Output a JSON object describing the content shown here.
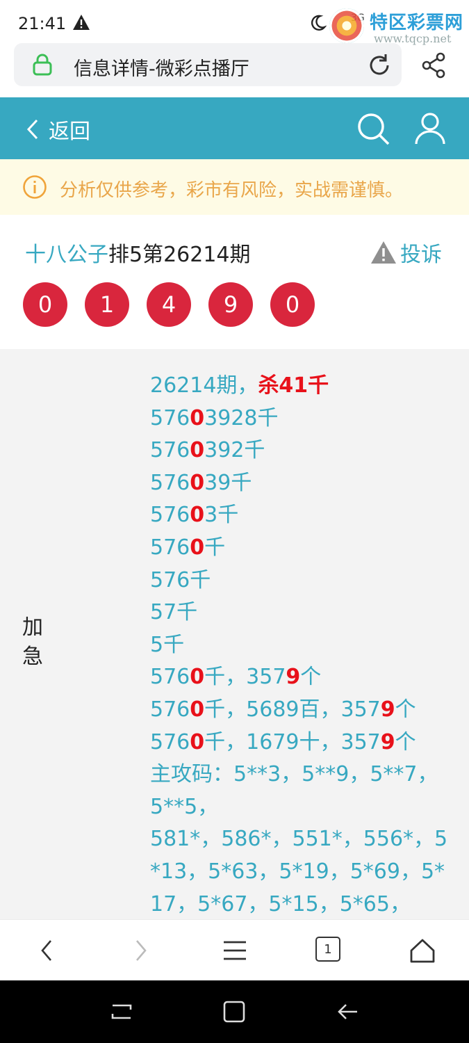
{
  "status": {
    "time": "21:41",
    "right_text": "3G"
  },
  "watermark": {
    "title": "特区彩票网",
    "url": "www.tqcp.net"
  },
  "browser": {
    "url_text": "信息详情-微彩点播厅"
  },
  "header": {
    "back_label": "返回"
  },
  "notice": {
    "text": "分析仅供参考，彩市有风险，实战需谨慎。"
  },
  "post": {
    "author": "十八公子",
    "title_rest": "排5第26214期",
    "complain_label": "投诉",
    "numbers": [
      "0",
      "1",
      "4",
      "9",
      "0"
    ]
  },
  "content": {
    "side_label": "加急",
    "lines": [
      [
        {
          "t": "26214期，"
        },
        {
          "t": "杀41千",
          "r": true
        }
      ],
      [
        {
          "t": "576"
        },
        {
          "t": "0",
          "r": true
        },
        {
          "t": "3928千"
        }
      ],
      [
        {
          "t": "576"
        },
        {
          "t": "0",
          "r": true
        },
        {
          "t": "392千"
        }
      ],
      [
        {
          "t": "576"
        },
        {
          "t": "0",
          "r": true
        },
        {
          "t": "39千"
        }
      ],
      [
        {
          "t": "576"
        },
        {
          "t": "0",
          "r": true
        },
        {
          "t": "3千"
        }
      ],
      [
        {
          "t": "576"
        },
        {
          "t": "0",
          "r": true
        },
        {
          "t": "千"
        }
      ],
      [
        {
          "t": "576千"
        }
      ],
      [
        {
          "t": "57千"
        }
      ],
      [
        {
          "t": "5千"
        }
      ],
      [
        {
          "t": "576"
        },
        {
          "t": "0",
          "r": true
        },
        {
          "t": "千，357"
        },
        {
          "t": "9",
          "r": true
        },
        {
          "t": "个"
        }
      ],
      [
        {
          "t": "576"
        },
        {
          "t": "0",
          "r": true
        },
        {
          "t": "千，5689百，357"
        },
        {
          "t": "9",
          "r": true
        },
        {
          "t": "个"
        }
      ],
      [
        {
          "t": "576"
        },
        {
          "t": "0",
          "r": true
        },
        {
          "t": "千，1679十，357"
        },
        {
          "t": "9",
          "r": true
        },
        {
          "t": "个"
        }
      ],
      [
        {
          "t": "主攻码：5**3，5**9，5**7，"
        }
      ],
      [
        {
          "t": "5**5，"
        }
      ],
      [
        {
          "t": "581*，586*，551*，556*，5"
        }
      ],
      [
        {
          "t": "*13，5*63，5*19，5*69，5*"
        }
      ],
      [
        {
          "t": "17，5*67，5*15，5*65，"
        }
      ]
    ]
  },
  "bottom_nav": {
    "tab_count": "1"
  },
  "colors": {
    "header": "#37a8c1",
    "ball": "#d9263d",
    "highlight": "#e8111a",
    "notice_text": "#e9a64a"
  }
}
